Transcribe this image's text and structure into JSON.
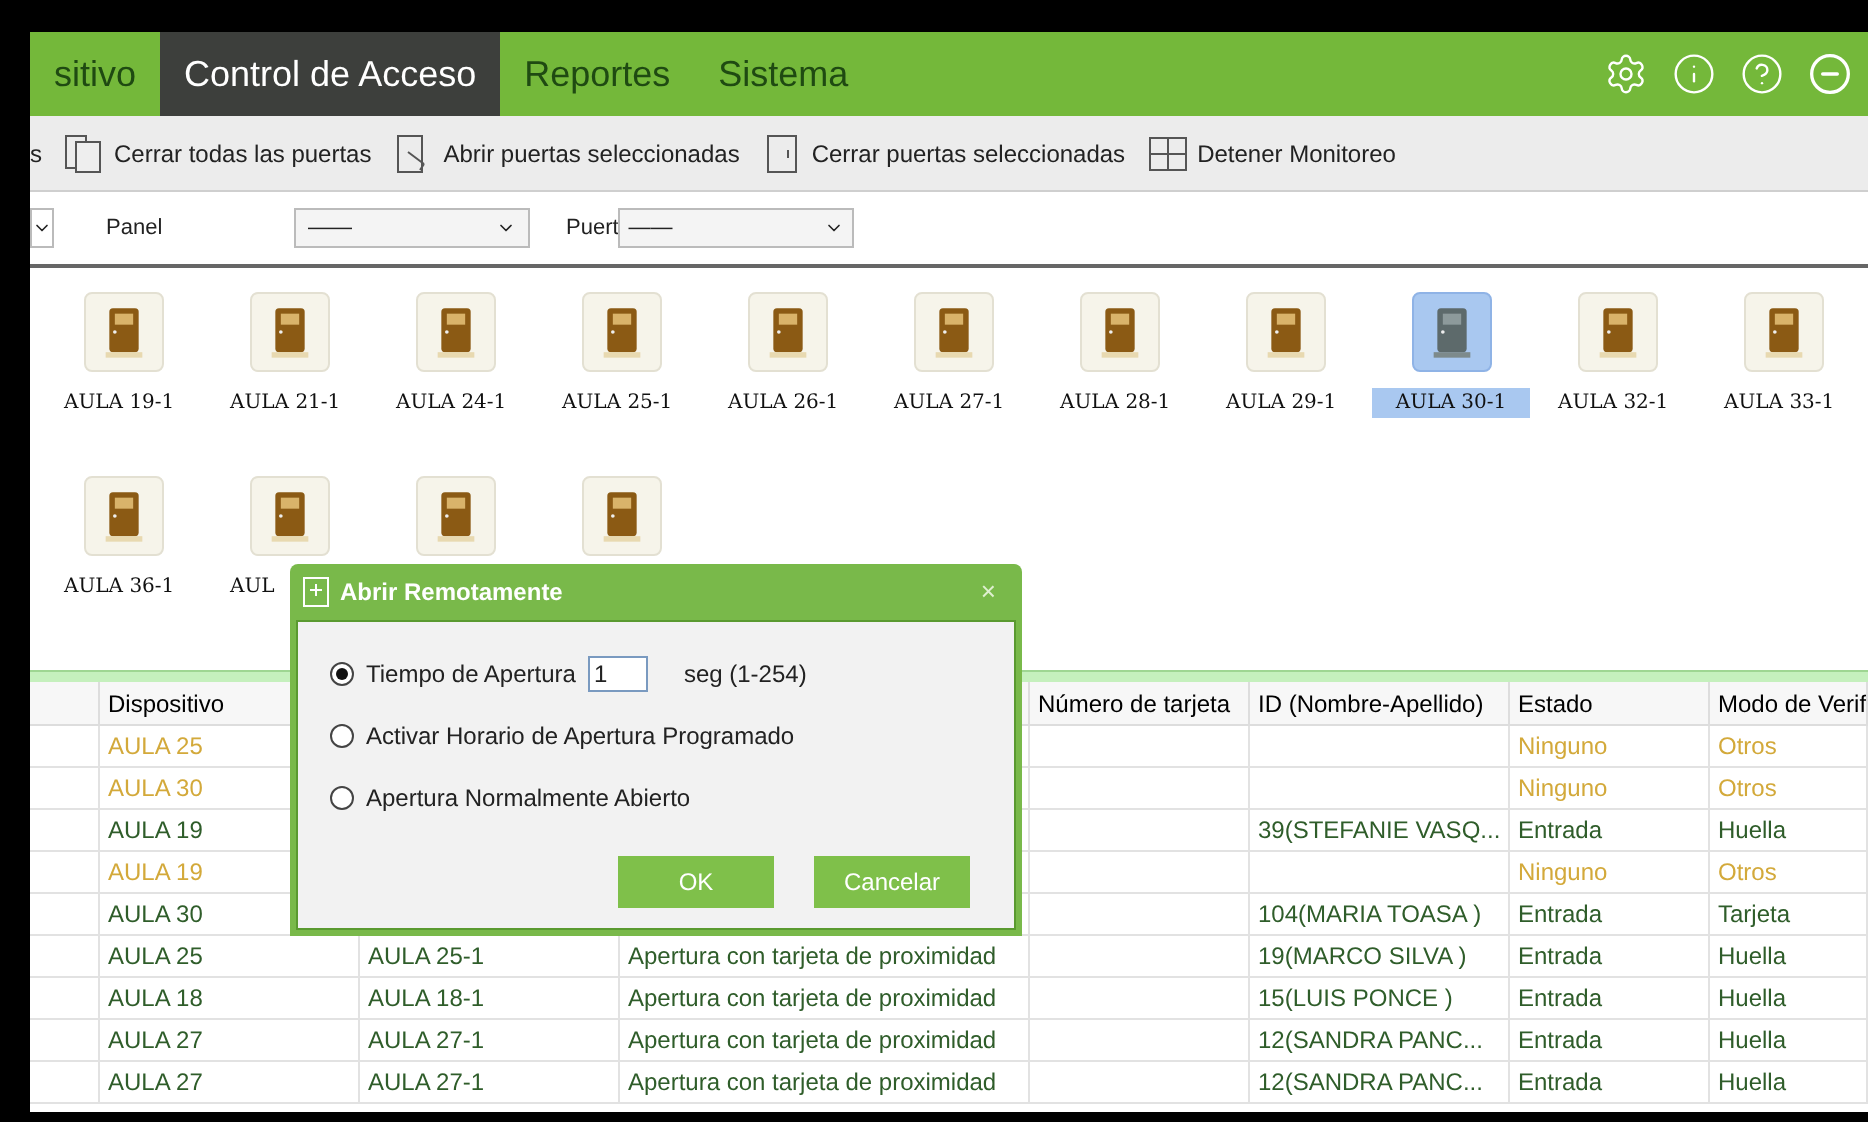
{
  "nav": {
    "tabs": [
      {
        "label": "sitivo",
        "selected": false
      },
      {
        "label": "Control de Acceso",
        "selected": true
      },
      {
        "label": "Reportes",
        "selected": false
      },
      {
        "label": "Sistema",
        "selected": false
      }
    ]
  },
  "toolbar": {
    "items": [
      {
        "label": "s",
        "kind": "plain"
      },
      {
        "label": "Cerrar todas las puertas",
        "kind": "closeall"
      },
      {
        "label": "Abrir puertas seleccionadas",
        "kind": "open"
      },
      {
        "label": "Cerrar puertas seleccionadas",
        "kind": "close"
      },
      {
        "label": "Detener Monitoreo",
        "kind": "monitor"
      }
    ]
  },
  "filters": {
    "panel_label": "Panel",
    "panel_value": "——",
    "door_label": "Puert",
    "door_value": "——"
  },
  "doors": [
    {
      "label": "AULA 19-1",
      "selected": false
    },
    {
      "label": "AULA 21-1",
      "selected": false
    },
    {
      "label": "AULA 24-1",
      "selected": false
    },
    {
      "label": "AULA 25-1",
      "selected": false
    },
    {
      "label": "AULA 26-1",
      "selected": false
    },
    {
      "label": "AULA 27-1",
      "selected": false
    },
    {
      "label": "AULA 28-1",
      "selected": false
    },
    {
      "label": "AULA 29-1",
      "selected": false
    },
    {
      "label": "AULA 30-1",
      "selected": true
    },
    {
      "label": "AULA 32-1",
      "selected": false
    },
    {
      "label": "AULA 33-1",
      "selected": false
    },
    {
      "label": "AULA 36-1",
      "selected": false
    },
    {
      "label": "AUL",
      "selected": false
    },
    {
      "selected": false
    },
    {
      "selected": false
    }
  ],
  "table": {
    "columns": [
      "Dispositivo",
      "Número de tarjeta",
      "ID (Nombre-Apellido)",
      "Estado",
      "Modo de Verif"
    ],
    "rows": [
      {
        "kind": "warning",
        "device": "AULA 25",
        "status": "Ninguno",
        "mode": "Otros"
      },
      {
        "kind": "warning",
        "device": "AULA 30",
        "status": "Ninguno",
        "mode": "Otros"
      },
      {
        "kind": "normal",
        "device": "AULA 19",
        "person": "39(STEFANIE VASQ...",
        "status": "Entrada",
        "mode": "Huella"
      },
      {
        "kind": "warning",
        "device": "AULA 19",
        "status": "Ninguno",
        "mode": "Otros"
      },
      {
        "kind": "normal",
        "device": "AULA 30",
        "person": "104(MARIA TOASA )",
        "status": "Entrada",
        "mode": "Tarjeta"
      },
      {
        "kind": "normal",
        "device": "AULA 25",
        "door": "AULA 25-1",
        "event": "Apertura con tarjeta de proximidad",
        "person": "19(MARCO SILVA )",
        "status": "Entrada",
        "mode": "Huella"
      },
      {
        "kind": "normal",
        "device": "AULA 18",
        "door": "AULA 18-1",
        "event": "Apertura con tarjeta de proximidad",
        "person": "15(LUIS PONCE )",
        "status": "Entrada",
        "mode": "Huella"
      },
      {
        "kind": "normal",
        "device": "AULA 27",
        "door": "AULA 27-1",
        "event": "Apertura con tarjeta de proximidad",
        "person": "12(SANDRA PANC...",
        "status": "Entrada",
        "mode": "Huella"
      },
      {
        "kind": "normal",
        "device": "AULA 27",
        "door": "AULA 27-1",
        "event": "Apertura con tarjeta de proximidad",
        "person": "12(SANDRA PANC...",
        "status": "Entrada",
        "mode": "Huella"
      }
    ]
  },
  "dialog": {
    "title": "Abrir Remotamente",
    "close": "×",
    "options": [
      {
        "label": "Tiempo de Apertura",
        "selected": true,
        "kind": "duration",
        "value": "1",
        "unit": "seg (1-254)"
      },
      {
        "label": "Activar Horario de Apertura Programado",
        "selected": false,
        "kind": "plain"
      },
      {
        "label": "Apertura Normalmente Abierto",
        "selected": false,
        "kind": "plain"
      }
    ],
    "buttons": [
      "OK",
      "Cancelar"
    ]
  }
}
